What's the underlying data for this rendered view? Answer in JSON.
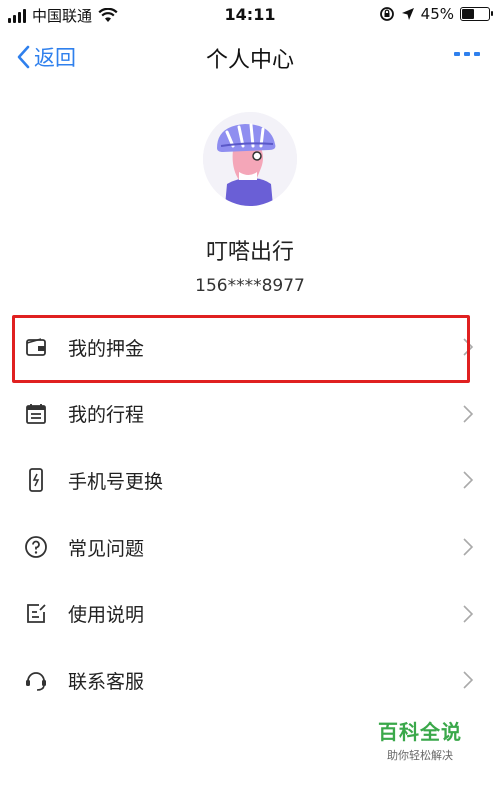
{
  "status_bar": {
    "carrier": "中国联通",
    "time": "14:11",
    "battery_percent": "45%",
    "battery_level": 0.45,
    "icons": [
      "signal-icon",
      "wifi-icon",
      "rotation-lock-icon",
      "location-icon",
      "battery-icon"
    ]
  },
  "nav": {
    "back_label": "返回",
    "title": "个人中心",
    "more_icon": "more-icon"
  },
  "profile": {
    "name": "叮嗒出行",
    "phone": "156****8977",
    "avatar_icon": "cyclist-avatar"
  },
  "menu": {
    "items": [
      {
        "label": "我的押金",
        "icon": "wallet-icon",
        "highlighted": true
      },
      {
        "label": "我的行程",
        "icon": "calendar-icon"
      },
      {
        "label": "手机号更换",
        "icon": "phone-icon"
      },
      {
        "label": "常见问题",
        "icon": "question-icon"
      },
      {
        "label": "使用说明",
        "icon": "instructions-icon"
      },
      {
        "label": "联系客服",
        "icon": "headset-icon"
      }
    ]
  },
  "watermark": {
    "title": "百科全说",
    "subtitle": "助你轻松解决"
  },
  "colors": {
    "accent": "#2f80ed",
    "highlight": "#e02020",
    "watermark": "#3aa84a"
  }
}
